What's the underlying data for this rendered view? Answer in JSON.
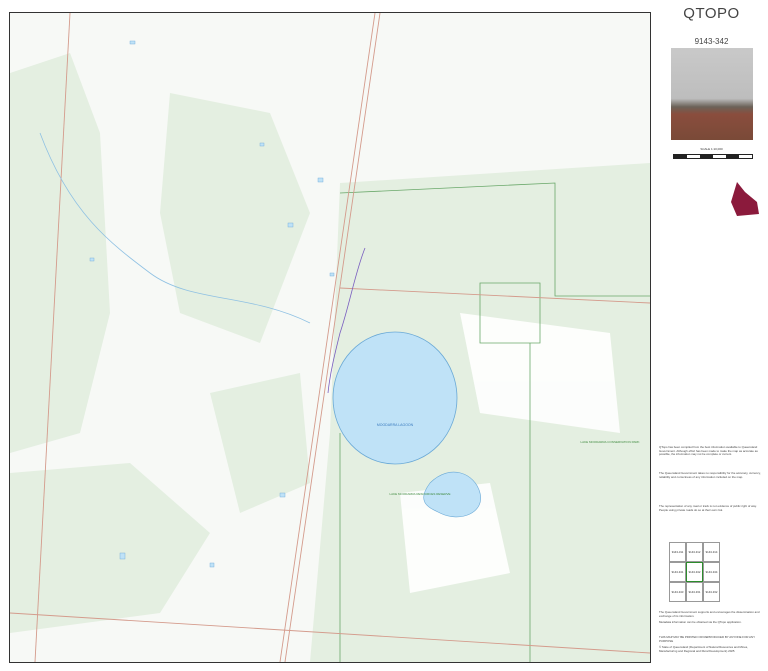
{
  "title": "QTOPO",
  "sheet_number": "9143-342",
  "scale_text": "SCALE 1:10,000",
  "map_labels": {
    "lagoon": "MOODARRA LAGOON",
    "reserve1": "LAKE MOODARRA CONSERVATION PARK",
    "reserve2": "LAKE MOODARRA RESOURCES RESERVE"
  },
  "paragraphs": [
    "QTopo has been compiled from the best information available to Queensland Government. Although effort has been made to make the map as accurate as possible, the information may not be complete or current.",
    "The Queensland Government takes no responsibility for the accuracy, currency, reliability and correctness of any information included on the map.",
    "The representation of any road or track is not evidence of public right of way. People using private roads do so at their own risk.",
    "The Queensland Government supports and encourages the dissemination and exchange of its information.",
    "Metadata information can be obtained via the QTopo application.",
    "THIS MAP MAY BE PRINTED OR REPRODUCED BY ANYONE FOR ANY PURPOSE"
  ],
  "adjoining_sheets": [
    "9143-311",
    "9143-312",
    "9143-314",
    "9143-341",
    "9143-342",
    "9143-344",
    "9143-343",
    "9143-331",
    "9143-332"
  ],
  "footer_copyright": "© State of Queensland (Department of Natural Resources and Mines, Manufacturing and Regional and Rural Development) 2025",
  "colors": {
    "water": "#bfe2f7",
    "reserve_border": "#6aa86a",
    "cadastre": "#d49b8c",
    "vegetation": "#e3eee0"
  }
}
